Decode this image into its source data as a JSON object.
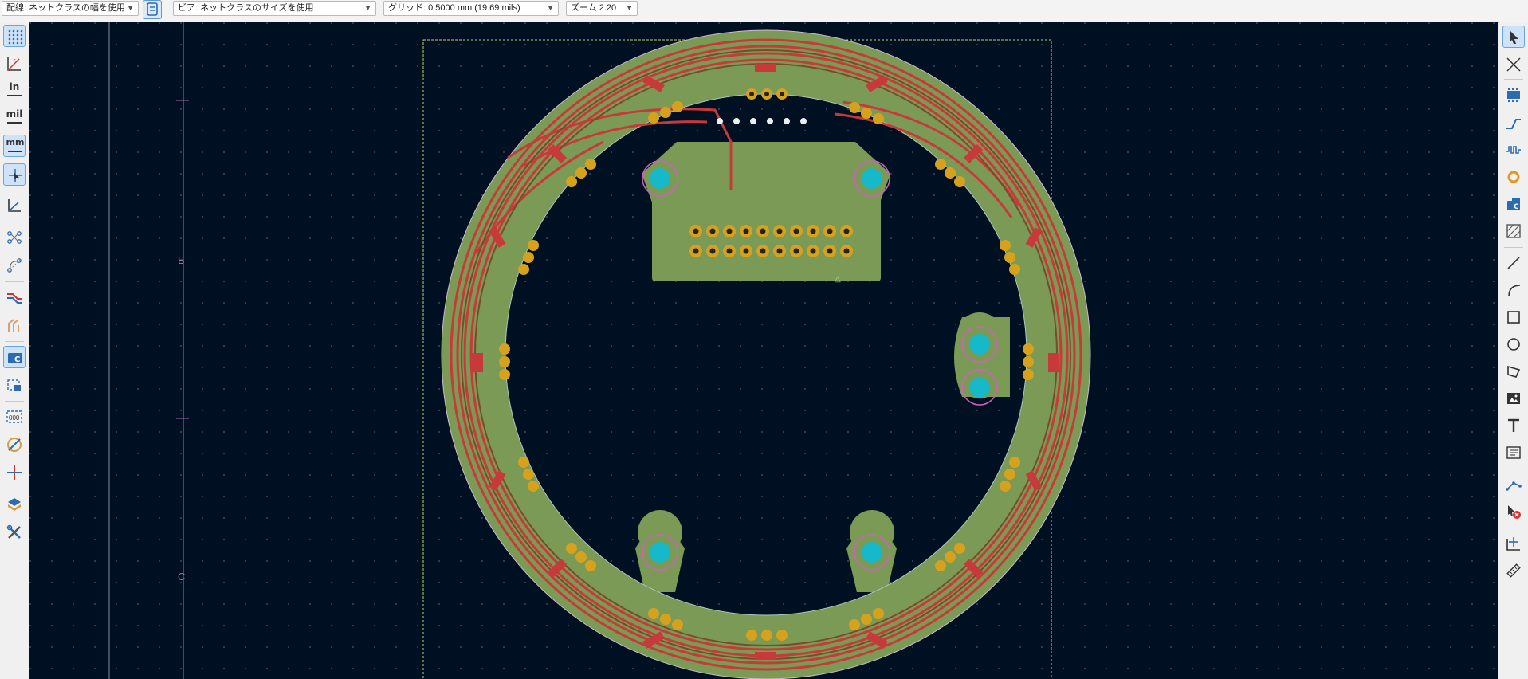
{
  "toolbar": {
    "track_width": "配線: ネットクラスの幅を使用",
    "via_size": "ビア: ネットクラスのサイズを使用",
    "grid": "グリッド: 0.5000 mm (19.69 mils)",
    "zoom": "ズーム 2.20"
  },
  "left_toolbar": {
    "units_in": "in",
    "units_mil": "mil",
    "units_mm": "mm"
  },
  "canvas": {
    "sheet_labels": [
      "B",
      "C"
    ],
    "background_color": "#001023",
    "board_color": "#7a9a55",
    "track_color": "#c83a3a",
    "pad_color": "#d6a21e",
    "hole_color": "#16b9c9"
  },
  "icons": {
    "left": [
      "grid-icon",
      "polar-coords-icon",
      "inches-icon",
      "mils-icon",
      "millimeters-icon",
      "cursor-shape-icon",
      "axis-icon",
      "ratsnest-icon",
      "curved-ratsnest-icon",
      "track-modes-icon",
      "via-modes-icon",
      "footprint-icon",
      "selection-filter-icon",
      "layer-pairs-icon",
      "zone-icon",
      "net-highlight-icon",
      "layers-icon",
      "settings-icon"
    ],
    "right": [
      "select-arrow-icon",
      "local-ratsnest-icon",
      "add-footprint-icon",
      "route-track-icon",
      "tune-length-icon",
      "add-via-icon",
      "add-zone-icon",
      "rule-area-icon",
      "draw-line-icon",
      "draw-arc-icon",
      "draw-rectangle-icon",
      "draw-circle-icon",
      "draw-polygon-icon",
      "add-image-icon",
      "add-text-icon",
      "add-textbox-icon",
      "add-dimension-icon",
      "delete-icon",
      "set-origin-icon",
      "measure-icon"
    ]
  }
}
